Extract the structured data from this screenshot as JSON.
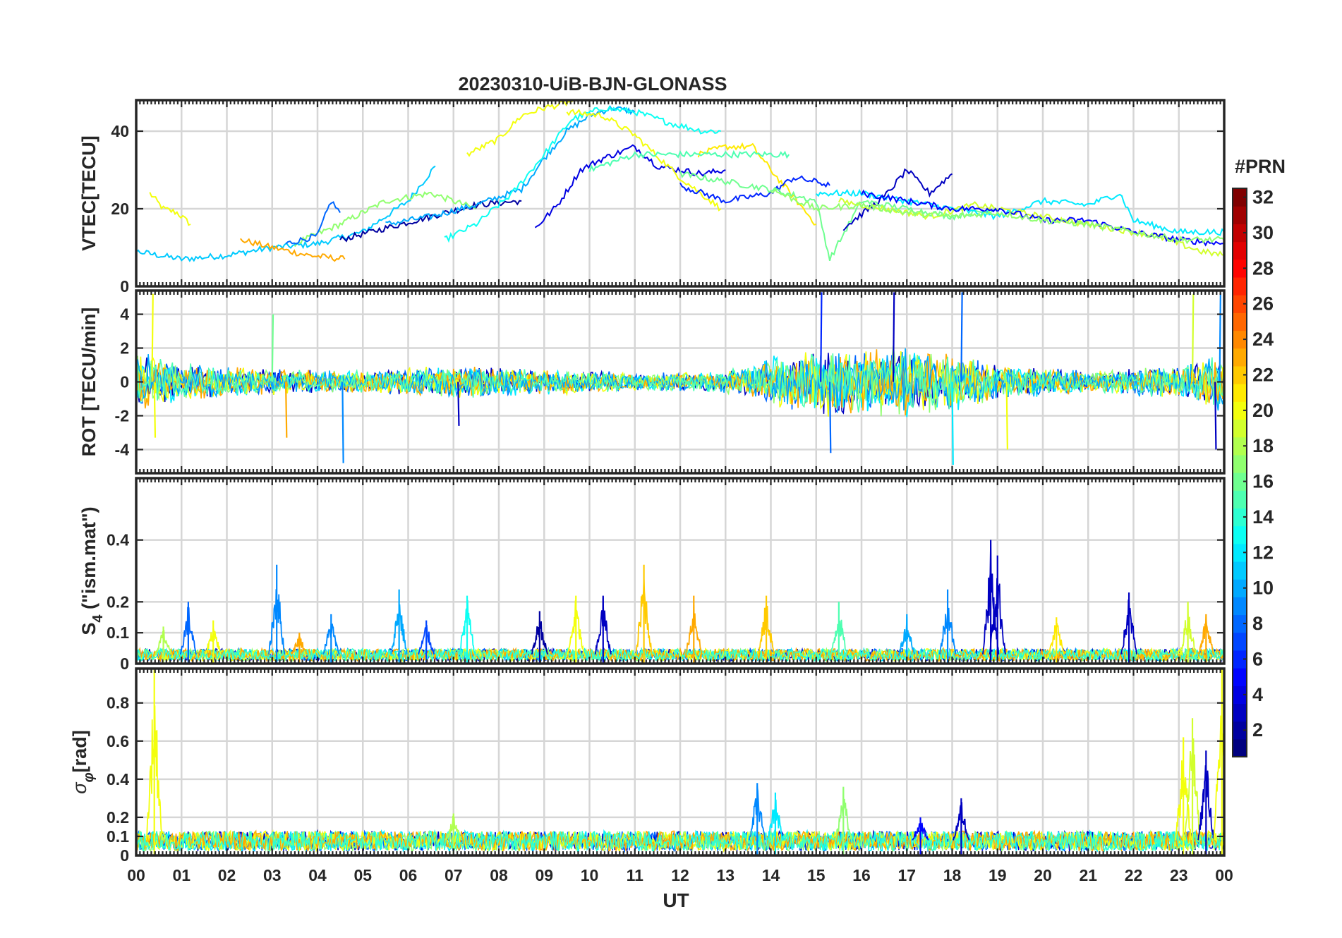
{
  "figure": {
    "title": "20230310-UiB-BJN-GLONASS",
    "xlabel": "UT",
    "x_ticks": [
      "00",
      "01",
      "02",
      "03",
      "04",
      "05",
      "06",
      "07",
      "08",
      "09",
      "10",
      "11",
      "12",
      "13",
      "14",
      "15",
      "16",
      "17",
      "18",
      "19",
      "20",
      "21",
      "22",
      "23",
      "00"
    ]
  },
  "colorbar": {
    "title": "#PRN",
    "ticks": [
      "2",
      "4",
      "6",
      "8",
      "10",
      "12",
      "14",
      "16",
      "18",
      "20",
      "22",
      "24",
      "26",
      "28",
      "30",
      "32"
    ],
    "colormap": "jet",
    "range": [
      1,
      32
    ]
  },
  "chart_data": [
    {
      "type": "line",
      "ylabel": "VTEC[TECU]",
      "ylim": [
        0,
        48
      ],
      "y_ticks": [
        "0",
        "20",
        "40"
      ],
      "y_tick_values": [
        0,
        20,
        40
      ],
      "grid": true,
      "series": [
        {
          "prn": 20,
          "x": [
            0.3,
            0.6,
            0.9,
            1.2
          ],
          "y": [
            24,
            20,
            19,
            16
          ]
        },
        {
          "prn": 11,
          "x": [
            0.0,
            1.0,
            2.0,
            3.0,
            4.0,
            5.0,
            6.0,
            6.6
          ],
          "y": [
            9,
            7,
            8,
            10,
            11,
            14,
            22,
            31
          ]
        },
        {
          "prn": 23,
          "x": [
            2.3,
            3.0,
            3.8,
            4.6
          ],
          "y": [
            12,
            10,
            8,
            7
          ]
        },
        {
          "prn": 17,
          "x": [
            3.5,
            4.5,
            5.5,
            6.5,
            7.5
          ],
          "y": [
            11,
            16,
            22,
            24,
            20
          ]
        },
        {
          "prn": 8,
          "x": [
            3.3,
            4.0,
            4.3,
            4.5
          ],
          "y": [
            11,
            13,
            22,
            19
          ]
        },
        {
          "prn": 2,
          "x": [
            4.5,
            5.5,
            6.5,
            7.5,
            8.5
          ],
          "y": [
            12,
            15,
            18,
            21,
            22
          ]
        },
        {
          "prn": 10,
          "x": [
            5.5,
            6.5,
            7.5,
            8.5,
            9.0,
            9.5,
            10.0,
            10.5,
            11.0
          ],
          "y": [
            16,
            18,
            21,
            25,
            33,
            40,
            44,
            46,
            45
          ]
        },
        {
          "prn": 20,
          "x": [
            7.3,
            8.0,
            8.5,
            9.0,
            9.4,
            9.7
          ],
          "y": [
            34,
            38,
            44,
            46,
            47,
            48
          ]
        },
        {
          "prn": 13,
          "x": [
            6.8,
            7.5,
            8.3,
            9.0,
            9.6,
            10.3,
            11.0,
            11.8,
            12.5,
            12.9
          ],
          "y": [
            12,
            16,
            24,
            34,
            43,
            46,
            45,
            42,
            40,
            40
          ]
        },
        {
          "prn": 4,
          "x": [
            8.8,
            9.3,
            9.8,
            10.3,
            11.0,
            11.5,
            12.5,
            13.0
          ],
          "y": [
            15,
            21,
            30,
            33,
            36,
            31,
            29,
            30
          ]
        },
        {
          "prn": 20,
          "x": [
            9.5,
            10.3,
            11.0,
            12.0,
            12.9
          ],
          "y": [
            45,
            44,
            39,
            28,
            20
          ]
        },
        {
          "prn": 21,
          "x": [
            12.4,
            13.0,
            13.6,
            14.0,
            14.5,
            15.0
          ],
          "y": [
            34,
            36,
            36,
            30,
            23,
            16
          ]
        },
        {
          "prn": 15,
          "x": [
            10.0,
            11.0,
            12.0,
            13.0,
            14.0,
            14.4
          ],
          "y": [
            30,
            34,
            34,
            34,
            34,
            34
          ]
        },
        {
          "prn": 6,
          "x": [
            12.0,
            13.0,
            14.0,
            14.5,
            15.0,
            15.3
          ],
          "y": [
            26,
            22,
            24,
            28,
            27,
            26
          ]
        },
        {
          "prn": 16,
          "x": [
            12.0,
            13.0,
            14.0,
            15.0,
            15.3,
            16.0,
            17.0,
            18.0,
            19.0
          ],
          "y": [
            29,
            27,
            25,
            22,
            7,
            22,
            20,
            18,
            20
          ]
        },
        {
          "prn": 3,
          "x": [
            15.6,
            16.5,
            17.0,
            17.5,
            18.0
          ],
          "y": [
            15,
            23,
            30,
            24,
            29
          ]
        },
        {
          "prn": 12,
          "x": [
            15.0,
            16.0,
            17.0,
            18.0,
            19.0,
            20.0,
            21.0,
            21.7,
            22.0,
            23.0,
            24.0
          ],
          "y": [
            24,
            24,
            22,
            20,
            18,
            22,
            21,
            24,
            17,
            14,
            14
          ]
        },
        {
          "prn": 19,
          "x": [
            15.5,
            16.5,
            17.5,
            18.5,
            19.5,
            20.5,
            21.5,
            22.5,
            23.5,
            24.0
          ],
          "y": [
            22,
            20,
            18,
            21,
            19,
            17,
            15,
            13,
            9,
            8
          ]
        },
        {
          "prn": 5,
          "x": [
            16.0,
            17.0,
            18.0,
            19.0,
            20.0,
            21.0,
            22.0,
            23.0,
            24.0
          ],
          "y": [
            24,
            22,
            20,
            20,
            17,
            17,
            14,
            12,
            11
          ]
        },
        {
          "prn": 17,
          "x": [
            14.0,
            15.0,
            16.0,
            17.0,
            18.0,
            19.0,
            20.0,
            21.0,
            22.0,
            23.0,
            24.0
          ],
          "y": [
            25,
            20,
            21,
            19,
            18,
            19,
            17,
            16,
            14,
            12,
            12
          ]
        }
      ]
    },
    {
      "type": "line",
      "ylabel": "ROT [TECU/min]",
      "ylim": [
        -5.4,
        5.4
      ],
      "y_ticks": [
        "-4",
        "-2",
        "0",
        "2",
        "4"
      ],
      "y_tick_values": [
        -4,
        -2,
        0,
        2,
        4
      ],
      "grid": true,
      "amplitude_profile": [
        {
          "x": 0,
          "amp": 1.6
        },
        {
          "x": 1,
          "amp": 1.0
        },
        {
          "x": 3,
          "amp": 0.7
        },
        {
          "x": 5,
          "amp": 0.6
        },
        {
          "x": 7,
          "amp": 0.9
        },
        {
          "x": 9,
          "amp": 0.7
        },
        {
          "x": 11,
          "amp": 0.5
        },
        {
          "x": 13,
          "amp": 0.6
        },
        {
          "x": 14,
          "amp": 1.4
        },
        {
          "x": 15,
          "amp": 1.8
        },
        {
          "x": 17,
          "amp": 1.9
        },
        {
          "x": 18,
          "amp": 1.6
        },
        {
          "x": 19,
          "amp": 1.0
        },
        {
          "x": 21,
          "amp": 0.6
        },
        {
          "x": 23,
          "amp": 0.9
        },
        {
          "x": 24,
          "amp": 1.6
        }
      ],
      "spikes": [
        {
          "x": 0.35,
          "y": 5.2,
          "prn": 20
        },
        {
          "x": 0.4,
          "y": -3.3,
          "prn": 20
        },
        {
          "x": 3.0,
          "y": 4.0,
          "prn": 16
        },
        {
          "x": 3.3,
          "y": -3.3,
          "prn": 23
        },
        {
          "x": 4.55,
          "y": -4.8,
          "prn": 9
        },
        {
          "x": 7.1,
          "y": -2.6,
          "prn": 3
        },
        {
          "x": 15.1,
          "y": 5.3,
          "prn": 6
        },
        {
          "x": 15.3,
          "y": -4.2,
          "prn": 8
        },
        {
          "x": 16.7,
          "y": 5.3,
          "prn": 3
        },
        {
          "x": 18.0,
          "y": -4.9,
          "prn": 12
        },
        {
          "x": 18.2,
          "y": 5.3,
          "prn": 8
        },
        {
          "x": 19.2,
          "y": -4.0,
          "prn": 20
        },
        {
          "x": 23.3,
          "y": 5.2,
          "prn": 19
        },
        {
          "x": 23.8,
          "y": -4.0,
          "prn": 3
        },
        {
          "x": 23.9,
          "y": 5.3,
          "prn": 9
        }
      ]
    },
    {
      "type": "line",
      "ylabel": "S4 (\"ism.mat\")",
      "ylabel_main": "S",
      "ylabel_sub": "4",
      "ylabel_rest": "(\"ism.mat\")",
      "ylim": [
        0,
        0.6
      ],
      "y_ticks": [
        "0",
        "0.1",
        "0.2",
        "0.4"
      ],
      "y_tick_values": [
        0,
        0.1,
        0.2,
        0.4
      ],
      "grid": true,
      "baseline": 0.03,
      "bursts": [
        {
          "x": 0.6,
          "y": 0.12,
          "prn": 18
        },
        {
          "x": 1.15,
          "y": 0.2,
          "prn": 8
        },
        {
          "x": 1.7,
          "y": 0.14,
          "prn": 20
        },
        {
          "x": 3.1,
          "y": 0.32,
          "prn": 9
        },
        {
          "x": 3.6,
          "y": 0.1,
          "prn": 23
        },
        {
          "x": 4.3,
          "y": 0.16,
          "prn": 9
        },
        {
          "x": 5.8,
          "y": 0.24,
          "prn": 10
        },
        {
          "x": 6.4,
          "y": 0.14,
          "prn": 7
        },
        {
          "x": 7.3,
          "y": 0.22,
          "prn": 13
        },
        {
          "x": 8.9,
          "y": 0.17,
          "prn": 2
        },
        {
          "x": 9.7,
          "y": 0.22,
          "prn": 20
        },
        {
          "x": 10.3,
          "y": 0.22,
          "prn": 3
        },
        {
          "x": 11.2,
          "y": 0.32,
          "prn": 22
        },
        {
          "x": 12.3,
          "y": 0.22,
          "prn": 23
        },
        {
          "x": 13.9,
          "y": 0.22,
          "prn": 22
        },
        {
          "x": 15.5,
          "y": 0.2,
          "prn": 15
        },
        {
          "x": 17.0,
          "y": 0.16,
          "prn": 10
        },
        {
          "x": 17.9,
          "y": 0.24,
          "prn": 9
        },
        {
          "x": 18.85,
          "y": 0.4,
          "prn": 3
        },
        {
          "x": 19.0,
          "y": 0.35,
          "prn": 3
        },
        {
          "x": 20.3,
          "y": 0.15,
          "prn": 21
        },
        {
          "x": 21.9,
          "y": 0.23,
          "prn": 3
        },
        {
          "x": 23.2,
          "y": 0.2,
          "prn": 19
        },
        {
          "x": 23.6,
          "y": 0.16,
          "prn": 23
        }
      ]
    },
    {
      "type": "line",
      "ylabel": "σφ[rad]",
      "ylabel_main": "σ",
      "ylabel_sub": "φ",
      "ylabel_rest": "[rad]",
      "ylim": [
        0,
        0.98
      ],
      "y_ticks": [
        "0",
        "0.1",
        "0.2",
        "0.4",
        "0.6",
        "0.8"
      ],
      "y_tick_values": [
        0,
        0.1,
        0.2,
        0.4,
        0.6,
        0.8
      ],
      "grid": true,
      "baseline": 0.08,
      "bursts": [
        {
          "x": 0.4,
          "y": 0.98,
          "prn": 20
        },
        {
          "x": 7.0,
          "y": 0.22,
          "prn": 18
        },
        {
          "x": 13.7,
          "y": 0.38,
          "prn": 9
        },
        {
          "x": 14.1,
          "y": 0.33,
          "prn": 12
        },
        {
          "x": 15.6,
          "y": 0.36,
          "prn": 17
        },
        {
          "x": 17.3,
          "y": 0.2,
          "prn": 5
        },
        {
          "x": 18.2,
          "y": 0.3,
          "prn": 3
        },
        {
          "x": 23.1,
          "y": 0.62,
          "prn": 20
        },
        {
          "x": 23.3,
          "y": 0.72,
          "prn": 19
        },
        {
          "x": 23.6,
          "y": 0.55,
          "prn": 3
        },
        {
          "x": 23.95,
          "y": 0.98,
          "prn": 20
        }
      ]
    }
  ]
}
